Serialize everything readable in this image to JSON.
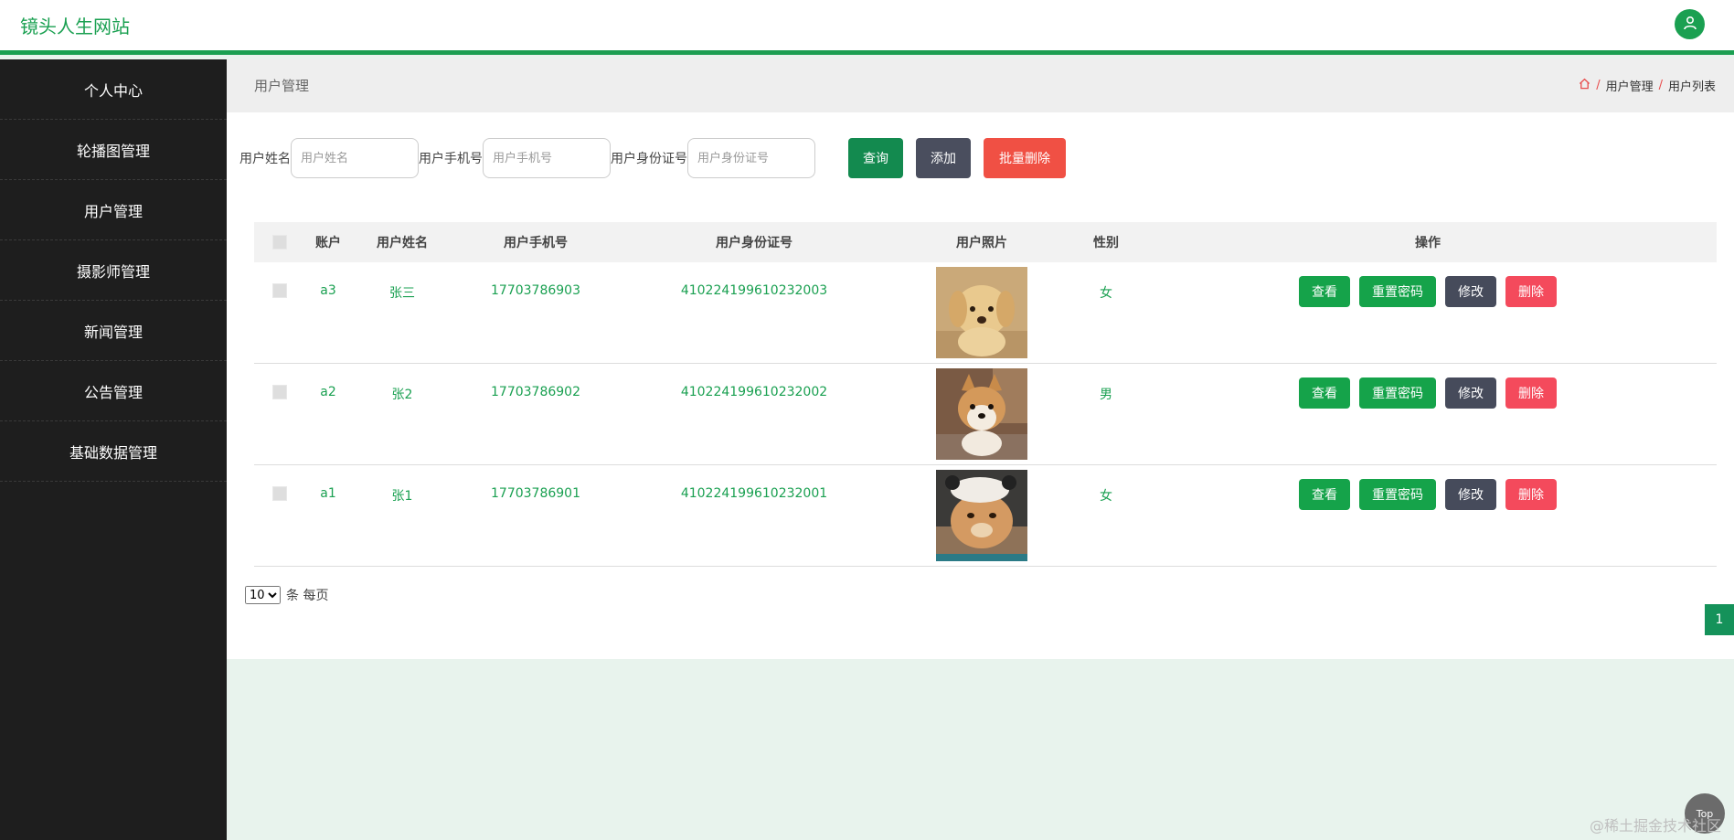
{
  "header": {
    "site_title": "镜头人生网站",
    "avatar_icon": "user-icon"
  },
  "sidebar": {
    "items": [
      {
        "label": "个人中心"
      },
      {
        "label": "轮播图管理"
      },
      {
        "label": "用户管理"
      },
      {
        "label": "摄影师管理"
      },
      {
        "label": "新闻管理"
      },
      {
        "label": "公告管理"
      },
      {
        "label": "基础数据管理"
      }
    ]
  },
  "page": {
    "title": "用户管理",
    "breadcrumb": {
      "home_icon": "home-icon",
      "items": [
        "用户管理",
        "用户列表"
      ],
      "separator": "/"
    }
  },
  "search": {
    "name_label": "用户姓名",
    "name_placeholder": "用户姓名",
    "phone_label": "用户手机号",
    "phone_placeholder": "用户手机号",
    "idcard_label": "用户身份证号",
    "idcard_placeholder": "用户身份证号",
    "query_btn": "查询",
    "add_btn": "添加",
    "batch_delete_btn": "批量删除"
  },
  "table": {
    "headers": [
      "账户",
      "用户姓名",
      "用户手机号",
      "用户身份证号",
      "用户照片",
      "性别",
      "操作"
    ],
    "rows": [
      {
        "account": "a3",
        "name": "张三",
        "phone": "17703786903",
        "idcard": "410224199610232003",
        "photo": "puppy",
        "gender": "女"
      },
      {
        "account": "a2",
        "name": "张2",
        "phone": "17703786902",
        "idcard": "410224199610232002",
        "photo": "shiba",
        "gender": "男"
      },
      {
        "account": "a1",
        "name": "张1",
        "phone": "17703786901",
        "idcard": "410224199610232001",
        "photo": "cat",
        "gender": "女"
      }
    ],
    "actions": {
      "view": "查看",
      "reset": "重置密码",
      "edit": "修改",
      "delete": "删除"
    }
  },
  "pagination": {
    "page_size": "10",
    "per_page_text": "条 每页",
    "current_page": "1"
  },
  "misc": {
    "top_button": "Top",
    "watermark": "@稀土掘金技术社区"
  },
  "colors": {
    "brand_green": "#1aa051",
    "sidebar_bg": "#1e1e1e",
    "danger": "#f44a5c",
    "dark_gray": "#464b5b"
  }
}
